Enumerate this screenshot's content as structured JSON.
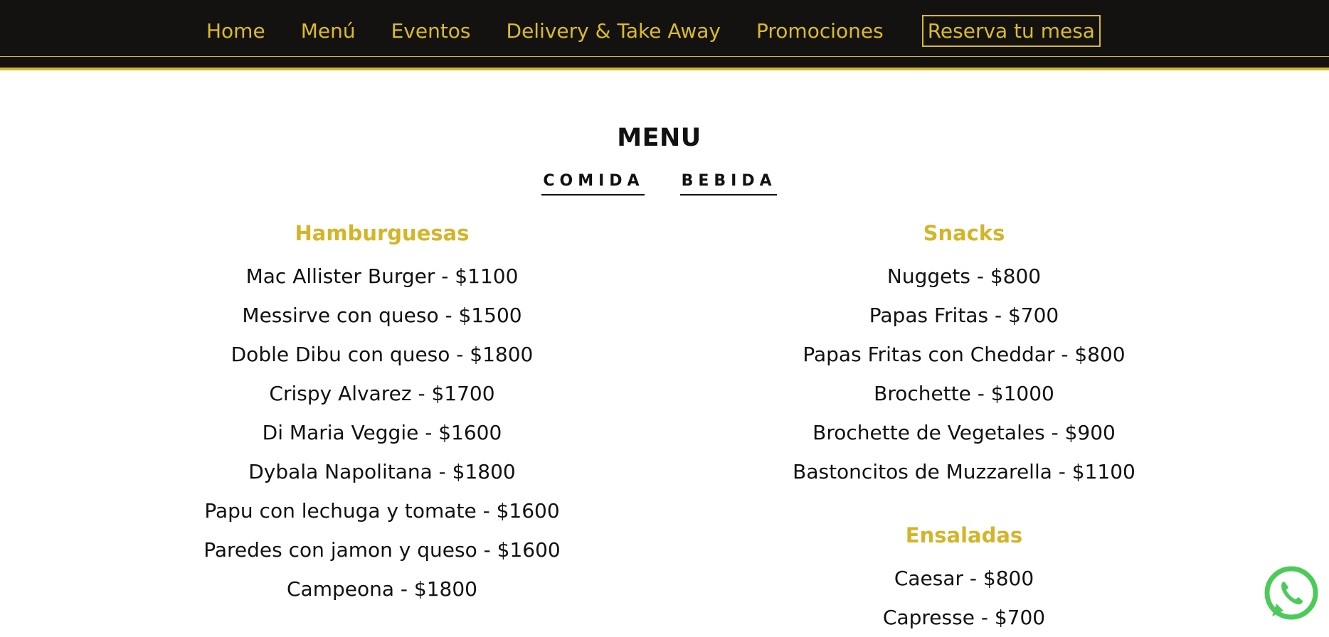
{
  "nav": {
    "links": [
      "Home",
      "Menú",
      "Eventos",
      "Delivery & Take Away",
      "Promociones"
    ],
    "cta": "Reserva tu mesa",
    "colors": {
      "background": "#141210",
      "accent": "#d9bb2c"
    }
  },
  "menu": {
    "title": "MENU",
    "tabs": [
      "COMIDA",
      "BEBIDA"
    ],
    "left": {
      "category": "Hamburguesas",
      "items": [
        "Mac Allister Burger - $1100",
        "Messirve con queso - $1500",
        "Doble Dibu con queso - $1800",
        "Crispy Alvarez - $1700",
        "Di Maria Veggie - $1600",
        "Dybala Napolitana - $1800",
        "Papu con lechuga y tomate - $1600",
        "Paredes con jamon y queso - $1600",
        "Campeona - $1800"
      ]
    },
    "right": [
      {
        "category": "Snacks",
        "items": [
          "Nuggets - $800",
          "Papas Fritas - $700",
          "Papas Fritas con Cheddar - $800",
          "Brochette - $1000",
          "Brochette de Vegetales - $900",
          "Bastoncitos de Muzzarella - $1100"
        ]
      },
      {
        "category": "Ensaladas",
        "items": [
          "Caesar - $800",
          "Capresse - $700"
        ]
      }
    ]
  },
  "floating": {
    "icon": "whatsapp-icon",
    "color": "#4ccb5a"
  }
}
